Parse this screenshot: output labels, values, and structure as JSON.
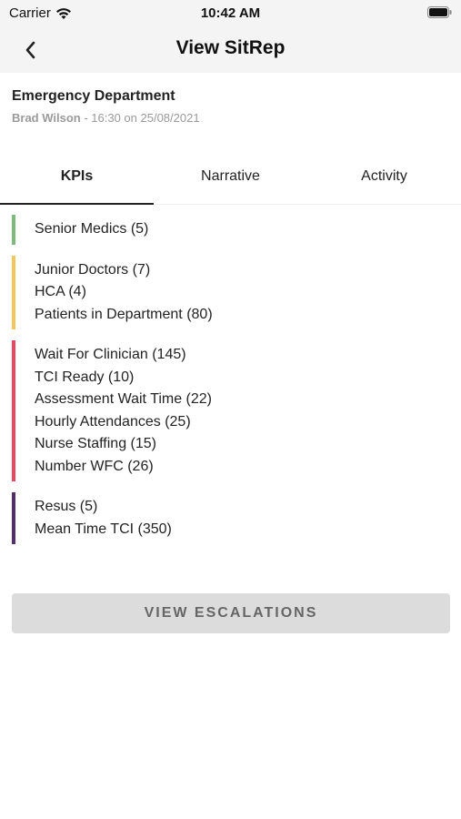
{
  "status_bar": {
    "carrier": "Carrier",
    "time": "10:42 AM",
    "icons": [
      "wifi-icon",
      "battery-icon"
    ]
  },
  "nav": {
    "title": "View SitRep",
    "back_icon": "chevron-left-icon"
  },
  "header": {
    "department": "Emergency Department",
    "author": "Brad Wilson",
    "timestamp": " - 16:30 on 25/08/2021"
  },
  "tabs": [
    {
      "label": "KPIs",
      "active": true
    },
    {
      "label": "Narrative",
      "active": false
    },
    {
      "label": "Activity",
      "active": false
    }
  ],
  "kpi_groups": [
    {
      "color": "#7dbb7d",
      "items": [
        "Senior Medics (5)"
      ]
    },
    {
      "color": "#f2c65c",
      "items": [
        "Junior Doctors (7)",
        "HCA (4)",
        "Patients in Department (80)"
      ]
    },
    {
      "color": "#e8475f",
      "items": [
        "Wait For Clinician (145)",
        "TCI Ready (10)",
        "Assessment Wait Time (22)",
        "Hourly Attendances (25)",
        "Nurse Staffing (15)",
        "Number WFC (26)"
      ]
    },
    {
      "color": "#54306b",
      "items": [
        "Resus (5)",
        "Mean Time TCI (350)"
      ]
    }
  ],
  "actions": {
    "escalations_label": "VIEW ESCALATIONS"
  }
}
